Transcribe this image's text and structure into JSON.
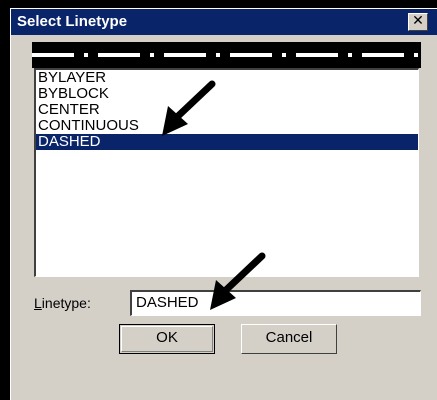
{
  "window": {
    "title": "Select Linetype",
    "close_glyph": "✕"
  },
  "linetypes": {
    "items": [
      "BYLAYER",
      "BYBLOCK",
      "CENTER",
      "CONTINUOUS",
      "DASHED"
    ],
    "selected_index": 4
  },
  "linetype_field": {
    "label_underlined": "L",
    "label_rest": "inetype:",
    "value": "DASHED"
  },
  "buttons": {
    "ok": "OK",
    "cancel": "Cancel"
  },
  "colors": {
    "titlebar": "#0a246a",
    "dialog_bg": "#d4d0c8",
    "selection": "#0a246a",
    "annotation_arrow": "#000000"
  },
  "icons": {
    "close": "close-icon",
    "annotation": "arrow-annotation-icon"
  }
}
